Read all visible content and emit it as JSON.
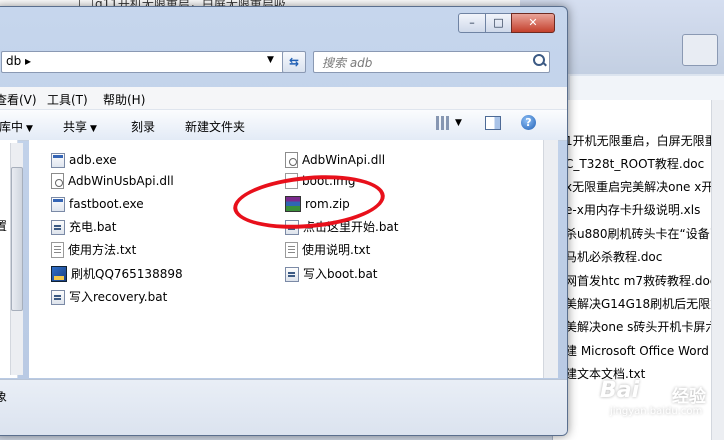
{
  "background_window": {
    "title": "g11开机无限重启，白屏无限重启吸",
    "files": [
      "1开机无限重启，白屏无限重启",
      "C_T328t_ROOT教程.doc",
      "x无限重启完美解决one x开",
      "e-x用内存卡升级说明.xls",
      "杀u880刷机砖头卡在“设备已",
      "马机必杀教程.doc",
      "网首发htc m7救砖教程.docx",
      "美解决G14G18刷机后无限重启",
      "美解决one s砖头开机卡屏六行",
      "建 Microsoft Office Word 2",
      "建文本文档.txt"
    ]
  },
  "window": {
    "buttons": {
      "minimize": "–",
      "maximize": "□",
      "close": "✕"
    },
    "address": "db ▸",
    "search_placeholder": "搜索 adb"
  },
  "menu": [
    "查看(V)",
    "工具(T)",
    "帮助(H)"
  ],
  "toolbar": {
    "organize": "库中",
    "share": "共享",
    "burn": "刻录",
    "new_folder": "新建文件夹"
  },
  "navpane": {
    "fragment": "置"
  },
  "files": [
    {
      "name": "adb.exe",
      "icon": "exe"
    },
    {
      "name": "AdbWinUsbApi.dll",
      "icon": "dll"
    },
    {
      "name": "fastboot.exe",
      "icon": "exe"
    },
    {
      "name": "充电.bat",
      "icon": "bat"
    },
    {
      "name": "使用方法.txt",
      "icon": "txt"
    },
    {
      "name": "刷机QQ765138898",
      "icon": "fw"
    },
    {
      "name": "写入recovery.bat",
      "icon": "bat"
    },
    {
      "name": "AdbWinApi.dll",
      "icon": "dll"
    },
    {
      "name": "boot.img",
      "icon": "img"
    },
    {
      "name": "rom.zip",
      "icon": "zip"
    },
    {
      "name": "点击这里开始.bat",
      "icon": "bat"
    },
    {
      "name": "使用说明.txt",
      "icon": "txt"
    },
    {
      "name": "写入boot.bat",
      "icon": "bat"
    }
  ],
  "status": "象",
  "watermark": {
    "brand": "Bai",
    "suffix": "经验",
    "url": "jingyan.baidu.com"
  }
}
